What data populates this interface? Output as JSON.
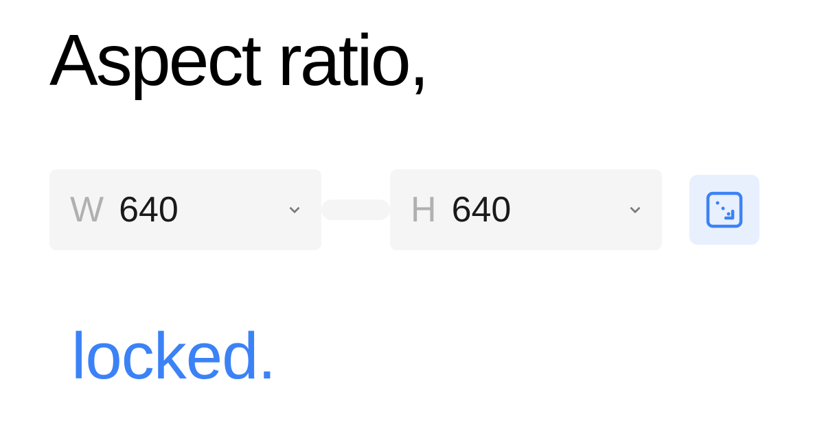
{
  "title": "Aspect ratio,",
  "dimensions": {
    "width": {
      "label": "W",
      "value": "640"
    },
    "height": {
      "label": "H",
      "value": "640"
    }
  },
  "subtitle": "locked.",
  "colors": {
    "accent": "#3b82f6",
    "inputBg": "#f5f5f5",
    "lockBg": "#e8f0fe",
    "labelMuted": "#b0b0b0"
  }
}
